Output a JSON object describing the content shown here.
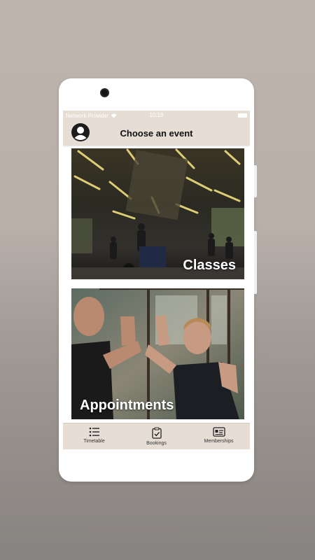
{
  "status": {
    "carrier": "Network Provider",
    "time": "10:16"
  },
  "header": {
    "title": "Choose an event",
    "avatar_icon": "account-circle-icon"
  },
  "events": [
    {
      "label": "Classes"
    },
    {
      "label": "Appointments"
    }
  ],
  "tabs": [
    {
      "label": "Timetable",
      "icon": "list-icon"
    },
    {
      "label": "Bookings",
      "icon": "clipboard-check-icon"
    },
    {
      "label": "Memberships",
      "icon": "membership-card-icon"
    }
  ],
  "colors": {
    "bar_background": "#e6ddd5",
    "phone_frame": "#ffffff"
  }
}
